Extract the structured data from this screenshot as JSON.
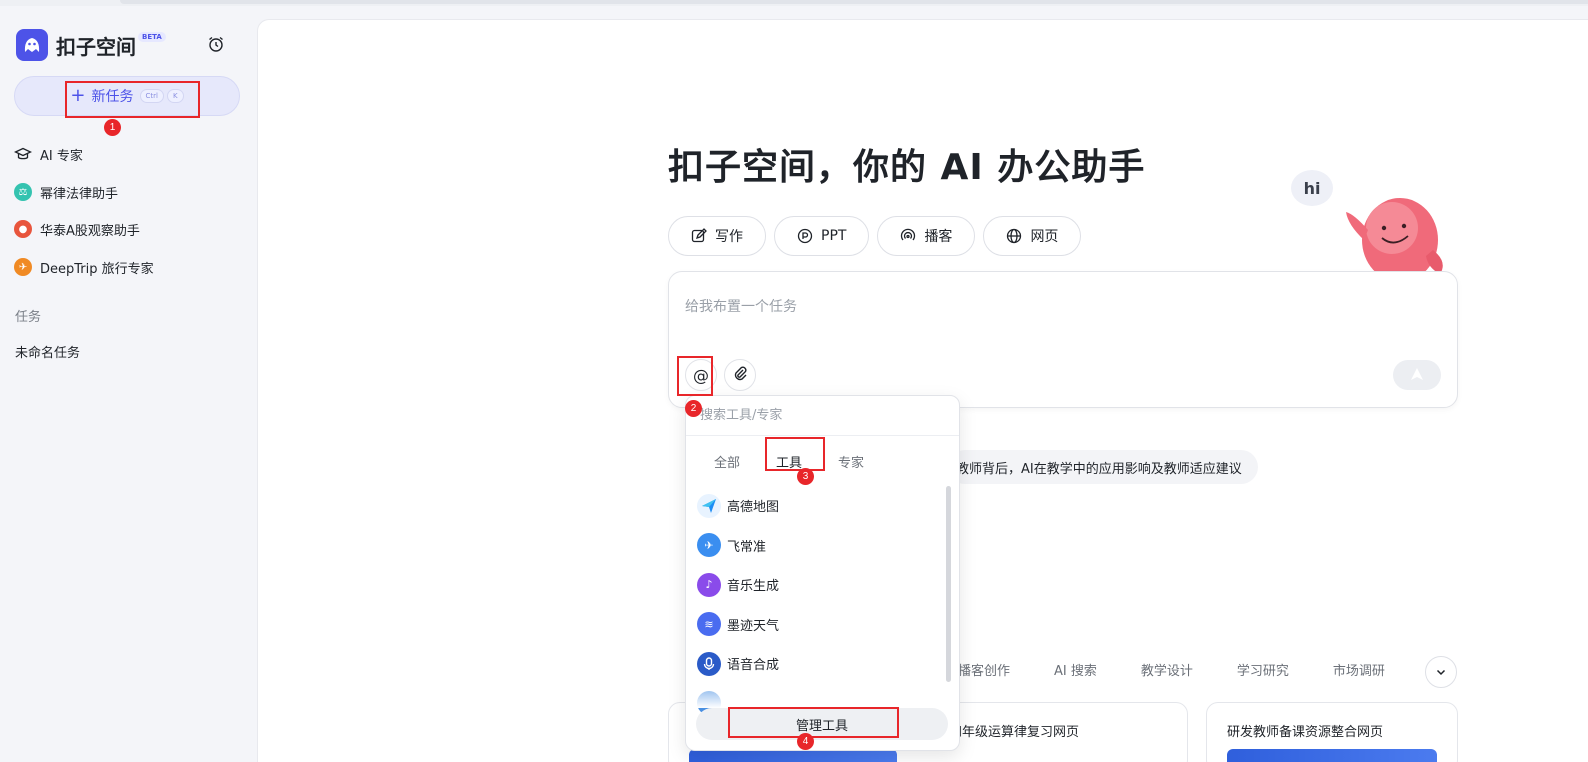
{
  "sidebar": {
    "logo_text": "扣子空间",
    "beta_badge": "BETA",
    "new_task": {
      "label": "新任务",
      "shortcut_1": "Ctrl",
      "shortcut_2": "K"
    },
    "experts": [
      {
        "label": "AI 专家",
        "icon": "graduation-cap-icon"
      },
      {
        "label": "幂律法律助手",
        "icon": "legal-assistant-icon",
        "color": "#34c3b0"
      },
      {
        "label": "华泰A股观察助手",
        "icon": "stock-assistant-icon",
        "color": "#e8553d"
      },
      {
        "label": "DeepTrip 旅行专家",
        "icon": "travel-expert-icon",
        "color": "#f08a24"
      }
    ],
    "section_label": "任务",
    "tasks": [
      "未命名任务"
    ]
  },
  "main": {
    "headline": "扣子空间，你的 AI 办公助手",
    "mascot_greeting": "hi",
    "modes": [
      {
        "label": "写作",
        "icon": "write-icon"
      },
      {
        "label": "PPT",
        "icon": "ppt-icon"
      },
      {
        "label": "播客",
        "icon": "podcast-icon"
      },
      {
        "label": "网页",
        "icon": "globe-icon"
      }
    ],
    "input": {
      "placeholder": "给我布置一个任务"
    },
    "suggestion": "教师背后，AI在教学中的应用影响及教师适应建议",
    "categories": [
      "播客创作",
      "AI 搜索",
      "教学设计",
      "学习研究",
      "市场调研"
    ],
    "cards": [
      {
        "title": ""
      },
      {
        "title": "四年级运算律复习网页"
      },
      {
        "title": "研发教师备课资源整合网页"
      }
    ]
  },
  "dropdown": {
    "search_placeholder": "搜索工具/专家",
    "tabs": [
      "全部",
      "工具",
      "专家"
    ],
    "active_tab": "工具",
    "tools": [
      {
        "label": "高德地图",
        "icon": "amap-icon",
        "color": "#1b8cf5"
      },
      {
        "label": "飞常准",
        "icon": "flight-icon",
        "color": "#3a8ef0"
      },
      {
        "label": "音乐生成",
        "icon": "music-icon",
        "color": "#8a4bea"
      },
      {
        "label": "墨迹天气",
        "icon": "weather-icon",
        "color": "#4a6cf0"
      },
      {
        "label": "语音合成",
        "icon": "microphone-icon",
        "color": "#2a5bc8"
      },
      {
        "label": "",
        "icon": "partial-tool-icon",
        "color": "#4a90e2"
      }
    ],
    "manage_button": "管理工具"
  },
  "annotations": [
    "1",
    "2",
    "3",
    "4"
  ],
  "colors": {
    "accent": "#4d53e8",
    "annotation": "#e8262a"
  }
}
